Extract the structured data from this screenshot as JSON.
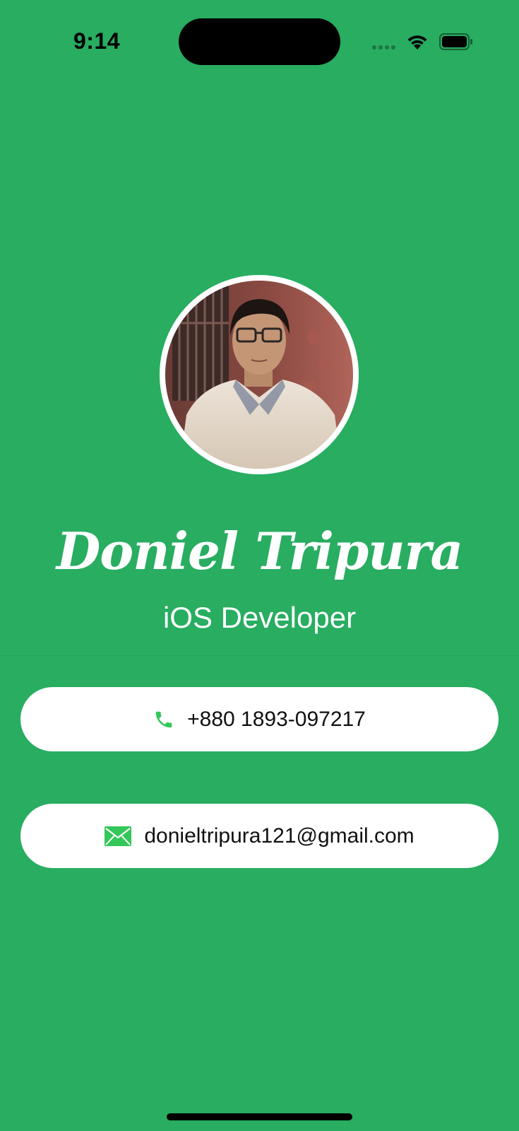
{
  "status_bar": {
    "time": "9:14",
    "icons": [
      "signal-dots-icon",
      "wifi-icon",
      "battery-icon"
    ]
  },
  "profile": {
    "name": "Doniel Tripura",
    "title": "iOS Developer",
    "avatar_alt": "profile photo"
  },
  "contacts": {
    "phone": {
      "icon": "phone-icon",
      "value": "+880 1893-097217"
    },
    "email": {
      "icon": "envelope-icon",
      "value": "donieltripura121@gmail.com"
    }
  },
  "colors": {
    "background": "#28AD61",
    "card": "#FFFFFF",
    "icon_accent": "#34C759",
    "text_on_bg": "#FFFFFF"
  }
}
